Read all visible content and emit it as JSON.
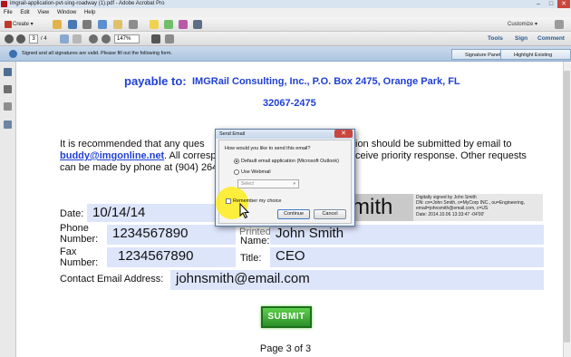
{
  "window": {
    "title": "imgrail-application-pvt-sing-roadway (1).pdf - Adobe Acrobat Pro",
    "min_label": "–",
    "max_label": "□",
    "close_label": "✕"
  },
  "menu": [
    "File",
    "Edit",
    "View",
    "Window",
    "Help"
  ],
  "toolbar": {
    "create_label": "Create",
    "customize_label": "Customize",
    "page_current": "3",
    "page_total": "/ 4",
    "zoom": "147%",
    "right_tabs": [
      "Tools",
      "Sign",
      "Comment"
    ]
  },
  "infobar": {
    "message": "Signed and all signatures are valid.  Please fill out the following form.",
    "signature_panel_label": "Signature Panel",
    "highlight_fields_label": "Highlight Existing Fields"
  },
  "document": {
    "payable_label": "payable to:",
    "payable_line1": "IMGRail Consulting, Inc., P.O. Box 2475, Orange Park, FL",
    "payable_line2": "32067-2475",
    "body_pre": "It is recommended that any ques",
    "body_pre2": "ion should be submitted by email to",
    "email_link": "buddy@imgonline.net",
    "body_mid": ".  All corresp",
    "body_mid2": "ceive priority response.  Other requests",
    "body_end": "can be made by phone at (904) 264",
    "date_label": "Date:",
    "date_value": "10/14/14",
    "phone_label": "Phone Number:",
    "phone_value": "1234567890",
    "fax_label": "Fax Number:",
    "fax_value": "1234567890",
    "printed_label_1": "Printed",
    "name_label": "Name:",
    "name_value": "John Smith",
    "title_label": "Title:",
    "title_value": "CEO",
    "contact_label": "Contact Email Address:",
    "contact_value": "johnsmith@email.com",
    "submit_label": "SUBMIT",
    "page_footer": "Page 3 of 3"
  },
  "signature": {
    "big_text": "mith",
    "line1": "Digitally signed by John Smith",
    "line2": "DN: cn=John Smith, o=MyCorp INC., ou=Engineering,",
    "line3": "email=johnsmith@email.com, c=US",
    "line4": "Date: 2014.10.06 13:33:47 -04'00'"
  },
  "dialog": {
    "title": "Send Email",
    "question": "How would you like to send this email?",
    "option1": "Default email application (Microsoft Outlook)",
    "option2": "Use Webmail",
    "select_placeholder": "Select",
    "remember_label": "Remember my choice",
    "continue_label": "Continue",
    "cancel_label": "Cancel"
  },
  "colors": {
    "link_blue": "#1f3fd6",
    "field_bg": "#dde5fb",
    "submit_green": "#2c8f2a",
    "highlight_yellow": "#ffeb14"
  }
}
